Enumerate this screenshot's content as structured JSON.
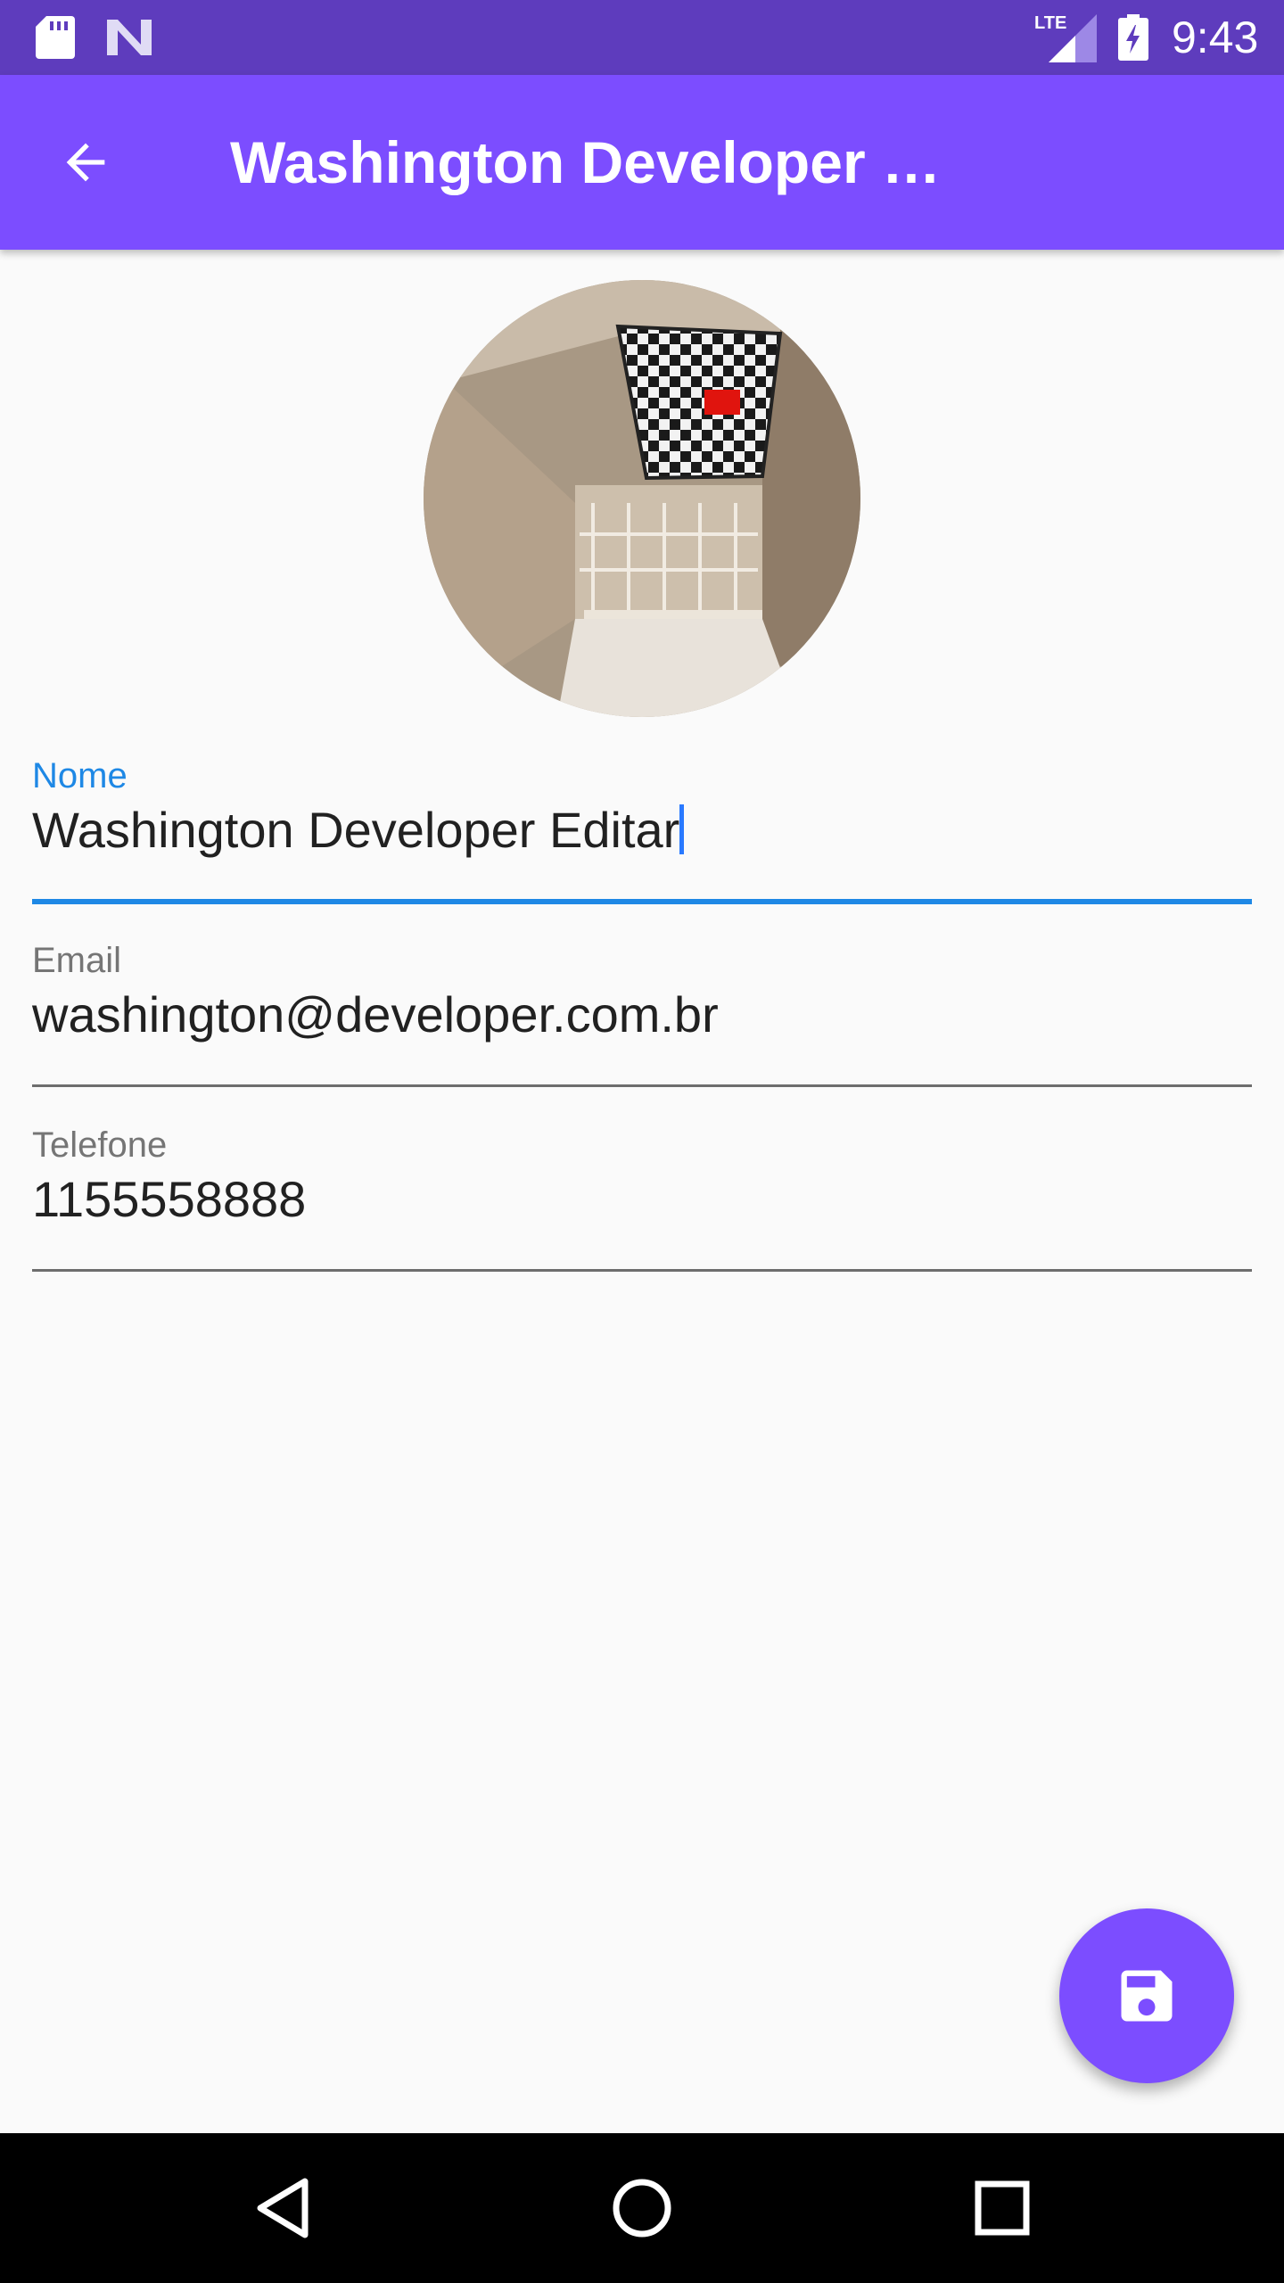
{
  "status_bar": {
    "time": "9:43",
    "network_label": "LTE",
    "icons": [
      "sd-card-icon",
      "n-notification-icon",
      "lte-signal-icon",
      "battery-charging-icon"
    ]
  },
  "app_bar": {
    "title": "Washington Developer  …",
    "back_icon": "arrow-back-icon"
  },
  "contact_photo": {
    "description_icon": "contact-photo"
  },
  "form": {
    "name": {
      "label": "Nome",
      "value": "Washington Developer  Editar"
    },
    "email": {
      "label": "Email",
      "value": "washington@developer.com.br"
    },
    "phone": {
      "label": "Telefone",
      "value": "1155558888"
    }
  },
  "fab": {
    "icon": "save-icon"
  },
  "colors": {
    "status_bar": "#5e3cbd",
    "primary": "#7c4dff",
    "focus_accent": "#1e88e5",
    "background": "#fafafa"
  },
  "nav_bar": {
    "icons": [
      "back-triangle-icon",
      "home-circle-icon",
      "recents-square-icon"
    ]
  }
}
